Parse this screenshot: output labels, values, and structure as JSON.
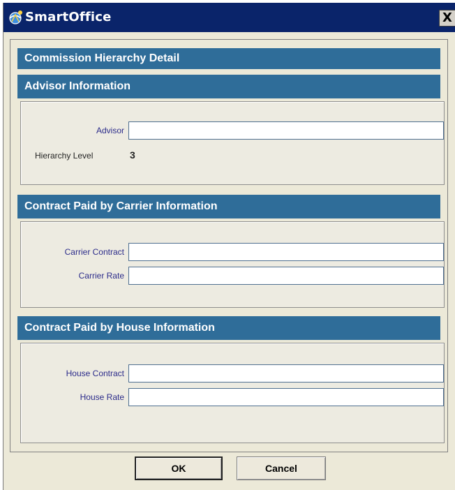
{
  "window": {
    "title": "SmartOffice",
    "close_symbol": "X",
    "icon": "browser-app-icon"
  },
  "sections": {
    "main_title": "Commission Hierarchy Detail",
    "advisor": {
      "title": "Advisor Information",
      "advisor_label": "Advisor",
      "advisor_value": "",
      "hierarchy_level_label": "Hierarchy Level",
      "hierarchy_level_value": "3"
    },
    "carrier": {
      "title": "Contract Paid by Carrier Information",
      "contract_label": "Carrier Contract",
      "contract_value": "",
      "rate_label": "Carrier Rate",
      "rate_value": ""
    },
    "house": {
      "title": "Contract Paid by House Information",
      "contract_label": "House Contract",
      "contract_value": "",
      "rate_label": "House Rate",
      "rate_value": ""
    }
  },
  "buttons": {
    "ok": "OK",
    "cancel": "Cancel"
  },
  "colors": {
    "titlebar": "#0a246a",
    "section_header": "#2f6d99",
    "dialog_bg": "#ece9d8"
  }
}
